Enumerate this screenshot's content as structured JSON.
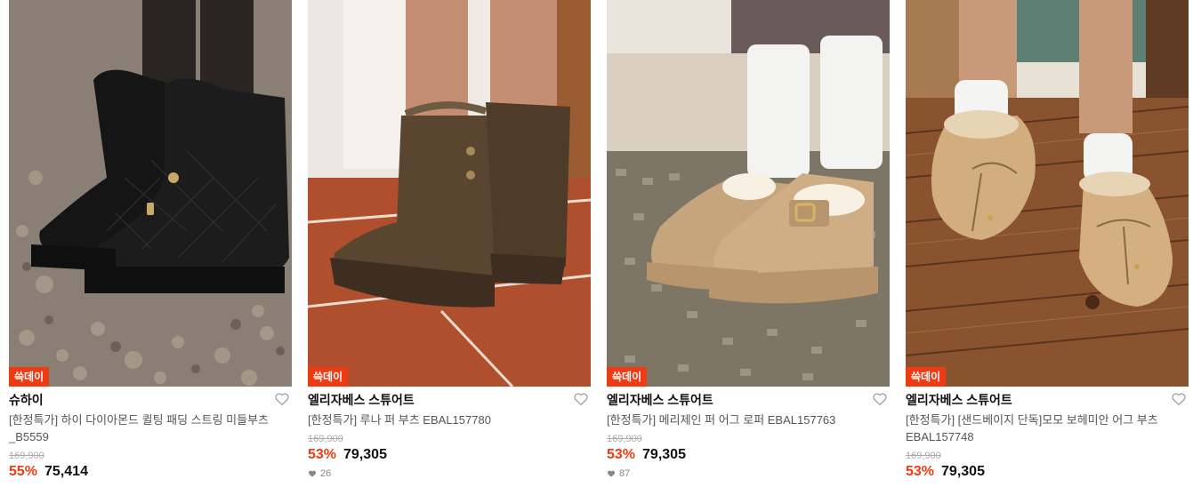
{
  "products": [
    {
      "badge": "쓱데이",
      "brand": "슈하이",
      "name": "[한정특가] 하이 다이아몬드 퀼팅 패딩 스트링 미들부츠_B5559",
      "original_price": "169,900",
      "discount": "55%",
      "price": "75,414",
      "likes": ""
    },
    {
      "badge": "쓱데이",
      "brand": "엘리자베스 스튜어트",
      "name": "[한정특가] 루나 퍼 부츠 EBAL157780",
      "original_price": "169,900",
      "discount": "53%",
      "price": "79,305",
      "likes": "26"
    },
    {
      "badge": "쓱데이",
      "brand": "엘리자베스 스튜어트",
      "name": "[한정특가] 메리제인 퍼 어그 로퍼 EBAL157763",
      "original_price": "169,900",
      "discount": "53%",
      "price": "79,305",
      "likes": "87"
    },
    {
      "badge": "쓱데이",
      "brand": "엘리자베스 스튜어트",
      "name": "[한정특가] [샌드베이지 단독]모모 보헤미안 어그 부츠 EBAL157748",
      "original_price": "169,900",
      "discount": "53%",
      "price": "79,305",
      "likes": ""
    }
  ],
  "colors": {
    "accent": "#ef3b11",
    "text": "#111111",
    "muted": "#555555"
  },
  "icons": {
    "wishlist": "heart-outline-icon",
    "likes": "heart-filled-icon"
  }
}
